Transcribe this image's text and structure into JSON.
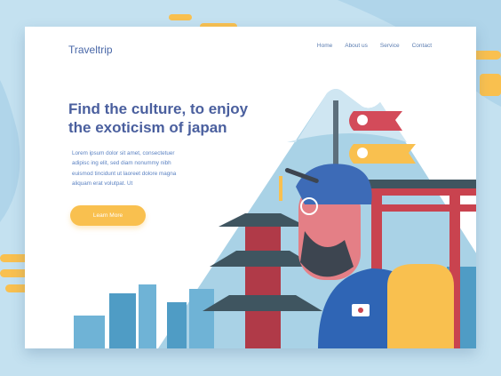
{
  "header": {
    "logo": "Traveltrip",
    "nav": [
      "Home",
      "About us",
      "Service",
      "Contact"
    ]
  },
  "hero": {
    "title": "Find the culture, to enjoy the exoticism of japan",
    "body": "Lorem ipsum dolor sit amet, consectetuer adipisc ing elit, sed diam nonummy nibh euismod tincidunt ut laoreet dolore magna aliquam erat volutpat. Ut",
    "cta": "Learn More"
  },
  "colors": {
    "accent": "#f9c04f",
    "title": "#4a5f9e",
    "bg": "#c4e1f0"
  }
}
